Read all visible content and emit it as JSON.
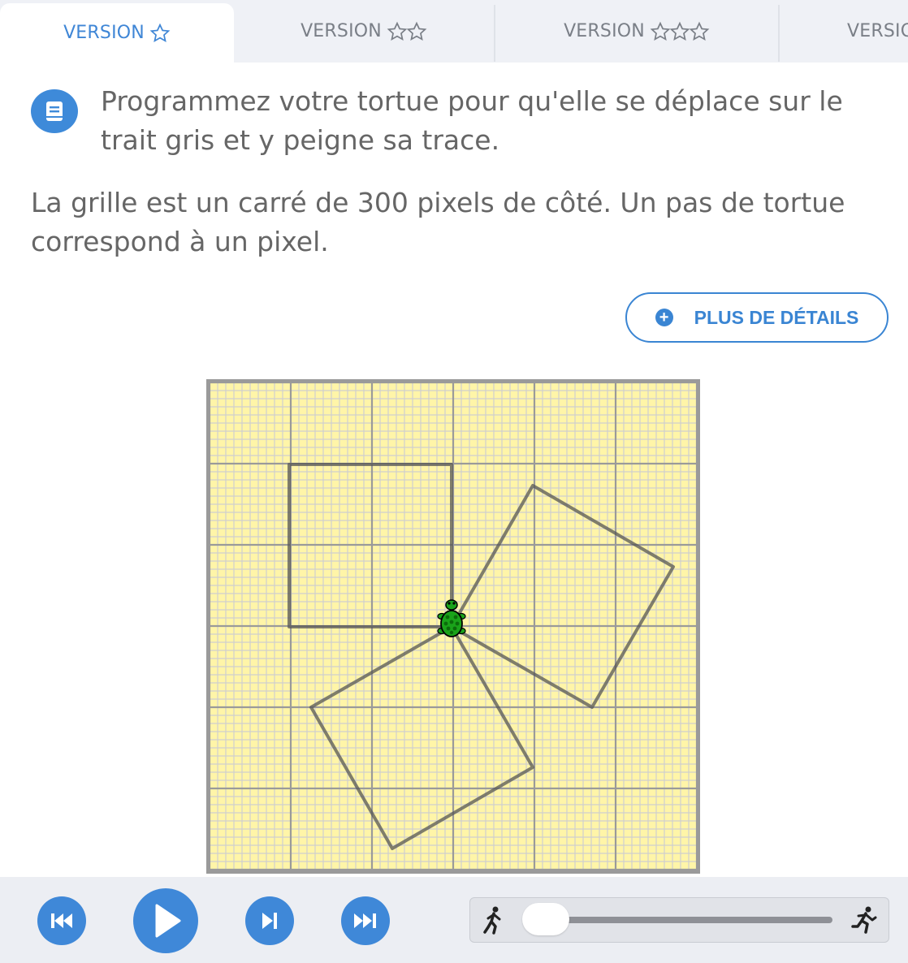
{
  "tabs": [
    {
      "label": "VERSION",
      "stars": 1,
      "active": true
    },
    {
      "label": "VERSION",
      "stars": 2,
      "active": false
    },
    {
      "label": "VERSION",
      "stars": 3,
      "active": false
    },
    {
      "label": "VERSIO",
      "stars": 0,
      "active": false
    }
  ],
  "instruction": {
    "icon": "book-icon",
    "text": "Programmez votre tortue pour qu'elle se déplace sur le trait gris et y peigne sa trace."
  },
  "description": "La grille est un carré de 300 pixels de côté. Un pas de tortue correspond à un pixel.",
  "details_button": {
    "icon": "plus-circle-icon",
    "label": "PLUS DE DÉTAILS"
  },
  "colors": {
    "accent": "#3f88d8",
    "grid_background": "#fff5a8",
    "trace": "#555555",
    "turtle": "#1aa31a"
  },
  "controls": {
    "buttons": [
      "rewind-icon",
      "play-icon",
      "step-icon",
      "fast-forward-icon"
    ],
    "speed_slider": {
      "min_icon": "walk-icon",
      "max_icon": "run-icon",
      "level": 0.1
    }
  }
}
